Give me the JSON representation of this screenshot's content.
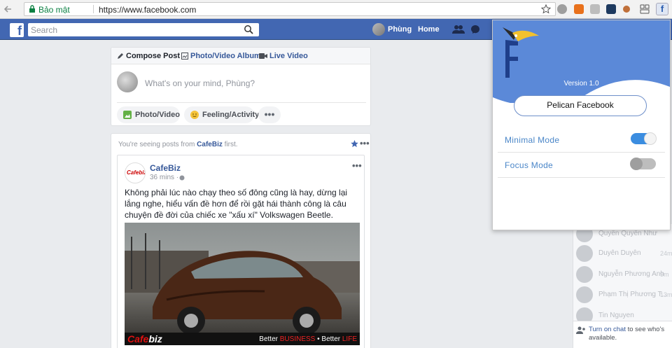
{
  "browser": {
    "secure_label": "Bảo mật",
    "url": "https://www.facebook.com"
  },
  "header": {
    "search_placeholder": "Search",
    "user_name": "Phùng",
    "home_label": "Home",
    "brand_color": "#4267b2"
  },
  "composer": {
    "tabs": [
      "Compose Post",
      "Photo/Video Album",
      "Live Video"
    ],
    "placeholder": "What's on your mind, Phùng?",
    "actions": [
      "Photo/Video",
      "Feeling/Activity",
      "•••"
    ]
  },
  "feed": {
    "notice_prefix": "You're seeing posts from",
    "notice_page": "CafeBiz",
    "notice_suffix": "first.",
    "post": {
      "author": "CafeBiz",
      "avatar_text": "Cafebiz",
      "time": "36 mins ·",
      "text": "Không phải lúc nào chạy theo số đông cũng là hay, dừng lại lắng nghe, hiểu vấn đề hơn để rồi gặt hái thành công là câu chuyện đề đời của chiếc xe \"xấu xí\" Volkswagen Beetle.",
      "image_brand_a": "Cafe",
      "image_brand_b": "biz",
      "image_tag_1": "Better",
      "image_tag_2": "BUSINESS",
      "image_tag_3": " • Better",
      "image_tag_4": "LIFE"
    }
  },
  "popup": {
    "version": "Version 1.0",
    "title": "Pelican Facebook",
    "options": [
      {
        "label": "Minimal Mode",
        "enabled": true
      },
      {
        "label": "Focus Mode",
        "enabled": false
      }
    ],
    "accent_color": "#3b8de0"
  },
  "chat": {
    "contacts": [
      {
        "name": "Quyên Quyên Như",
        "time": ""
      },
      {
        "name": "Duyên Duyên",
        "time": "24m"
      },
      {
        "name": "Nguyễn Phương Anh",
        "time": "9m"
      },
      {
        "name": "Phạm Thị Phương T...",
        "time": "13m"
      },
      {
        "name": "Tin Nguyen",
        "time": ""
      }
    ],
    "footer_link": "Turn on chat",
    "footer_text": " to see who's available."
  }
}
